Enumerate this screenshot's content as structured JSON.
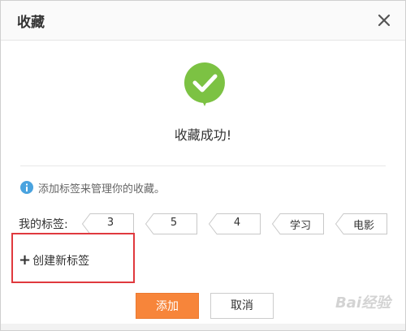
{
  "dialog": {
    "title": "收藏",
    "close_icon": "close-icon",
    "success_icon": "checkmark-bubble-icon",
    "success_text": "收藏成功!",
    "hint_icon": "info-icon",
    "hint_text": "添加标签来管理你的收藏。",
    "tags_label": "我的标签:",
    "tags": [
      "3",
      "5",
      "4",
      "学习",
      "电影"
    ],
    "create_label": "创建新标签",
    "add_button": "添加",
    "cancel_button": "取消",
    "watermark": "Bai经验"
  },
  "colors": {
    "success_green": "#7cc243",
    "info_blue": "#4aa3df",
    "highlight_red": "#e0393e",
    "primary_orange": "#f7853a"
  }
}
